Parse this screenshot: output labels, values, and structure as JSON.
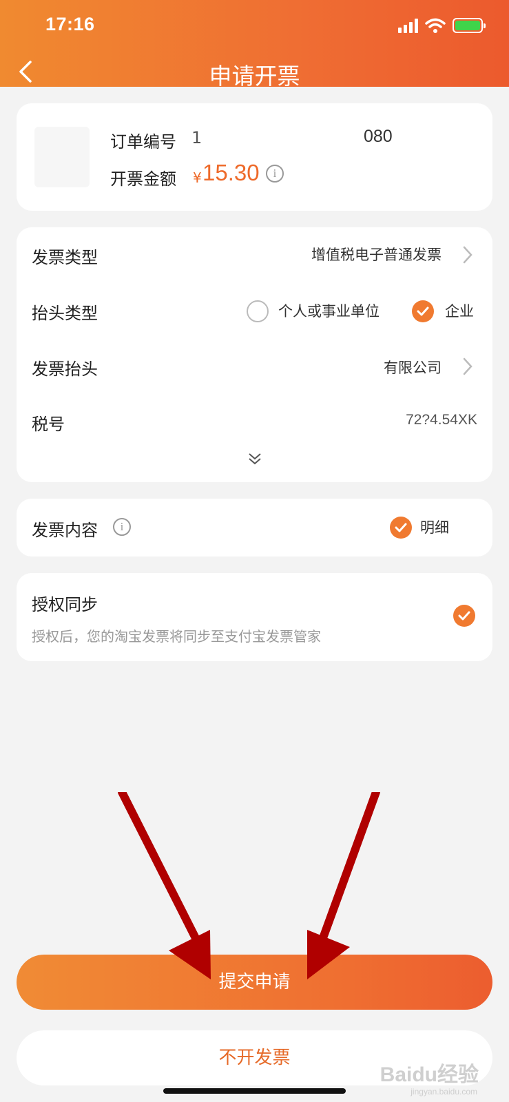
{
  "status_bar": {
    "time": "17:16"
  },
  "nav": {
    "title": "申请开票"
  },
  "order": {
    "order_no_label": "订单编号",
    "order_no_value_start": "1́",
    "order_no_value_end": "080",
    "amount_label": "开票金额",
    "currency": "¥",
    "amount": "15.30"
  },
  "invoice": {
    "type_label": "发票类型",
    "type_value": "增值税电子普通发票",
    "header_type_label": "抬头类型",
    "option_personal": "个人或事业单位",
    "option_company": "企业",
    "title_label": "发票抬头",
    "title_value": "有限公司",
    "tax_label": "税号",
    "tax_value": "72?4.54XK"
  },
  "content": {
    "label": "发票内容",
    "option": "明细"
  },
  "auth": {
    "title": "授权同步",
    "desc": "授权后，您的淘宝发票将同步至支付宝发票管家"
  },
  "buttons": {
    "submit": "提交申请",
    "no_invoice": "不开发票"
  },
  "watermark": {
    "brand": "Baidu经验",
    "sub": "jingyan.baidu.com"
  },
  "colors": {
    "accent": "#f07a30",
    "brand_orange": "#ec5a2d",
    "arrow_red": "#b00000"
  },
  "icons": [
    "signal-icon",
    "wifi-icon",
    "battery-charging-icon",
    "back-icon",
    "chevron-right-icon",
    "info-icon",
    "check-icon",
    "expand-down-icon"
  ]
}
